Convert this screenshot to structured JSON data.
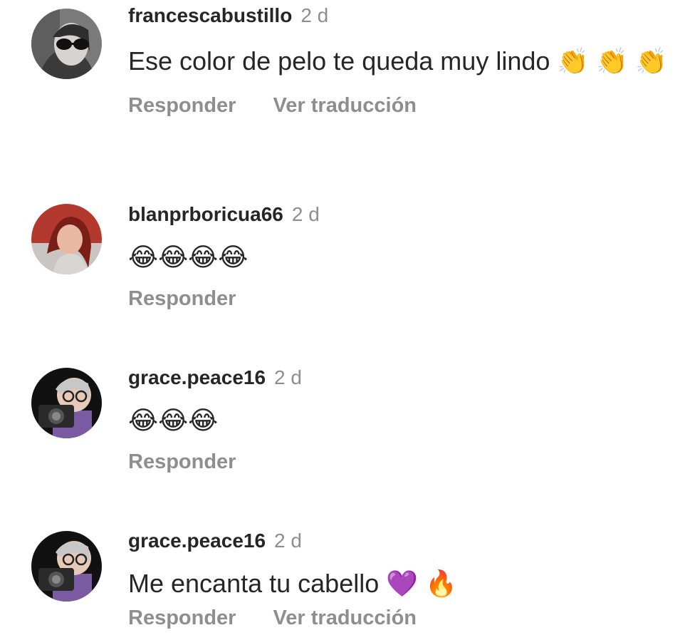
{
  "comments": [
    {
      "username": "francescabustillo",
      "time": "2 d",
      "text": "Ese color de pelo  te queda muy lindo 👏 👏 👏",
      "reply_label": "Responder",
      "translate_label": "Ver traducción"
    },
    {
      "username": "blanprboricua66",
      "time": "2 d",
      "text": "😂😂😂😂",
      "reply_label": "Responder"
    },
    {
      "username": "grace.peace16",
      "time": "2 d",
      "text": "😂😂😂",
      "reply_label": "Responder"
    },
    {
      "username": "grace.peace16",
      "time": "2 d",
      "text": "Me encanta tu cabello 💜 🔥",
      "reply_label": "Responder",
      "translate_label": "Ver traducción"
    }
  ],
  "colors": {
    "username": "#262626",
    "secondary": "#8e8e8e"
  }
}
